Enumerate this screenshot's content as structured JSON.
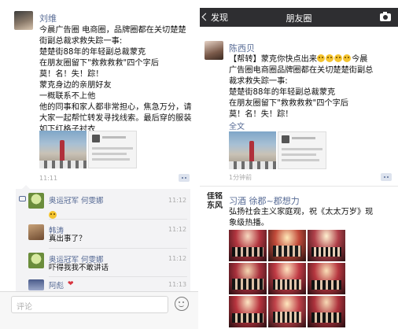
{
  "left": {
    "post": {
      "author": "刘维",
      "lines": [
        "今晨广告圈 电商圈，品牌圈都在关切楚楚",
        "街副总裁求救失踪一事:",
        "楚楚街88年的年轻副总裁蒙克",
        "在朋友圈留下\"救救救救\"四个字后",
        "莫！名！失！踪！",
        "蒙克身边的亲朋好友",
        "一概联系不上他",
        "他的同事和家人都非常担心，焦急万分，请",
        "大家一起帮忙转发寻找线索。最后穿的服装",
        "如下红格子衬衣"
      ],
      "time": "11:11"
    },
    "comments": [
      {
        "author": "奥运冠军 何雯娜",
        "text": "",
        "time": "11:12"
      },
      {
        "author": "韩涛",
        "text": "真出事了？",
        "time": "11:12"
      },
      {
        "author": "奥运冠军 何雯娜",
        "text": "吓得我我不敢讲话",
        "time": "11:12"
      },
      {
        "author": "阿彪",
        "text": "",
        "time": "11:13"
      }
    ],
    "comment_placeholder": "评论"
  },
  "right": {
    "nav": {
      "back_label": "发现",
      "title": "朋友圈"
    },
    "post1": {
      "author": "陈西贝",
      "prefix": "【帮转】蒙克你快点出来",
      "suffix": "今晨",
      "lines": [
        "广告圈电商圈品牌圈都在关切楚楚街副总",
        "裁求救失踪一事:",
        "楚楚街88年的年轻副总裁蒙克",
        "在朋友圈留下\"救救救救\"四个字后",
        "莫！名！失！踪！"
      ],
      "full_text_link": "全文",
      "time": "1分钟前"
    },
    "post2": {
      "author": "习酒 徐郡~郡想力",
      "lines": [
        "弘扬社会主义家庭观，祝《太太万岁》现",
        "象级热播。"
      ],
      "avatar_text": "佳铭 东风"
    }
  },
  "colors": {
    "name_blue": "#576b95",
    "nav_bg": "#2e2e31",
    "comment_bg": "#f3f3f5"
  }
}
